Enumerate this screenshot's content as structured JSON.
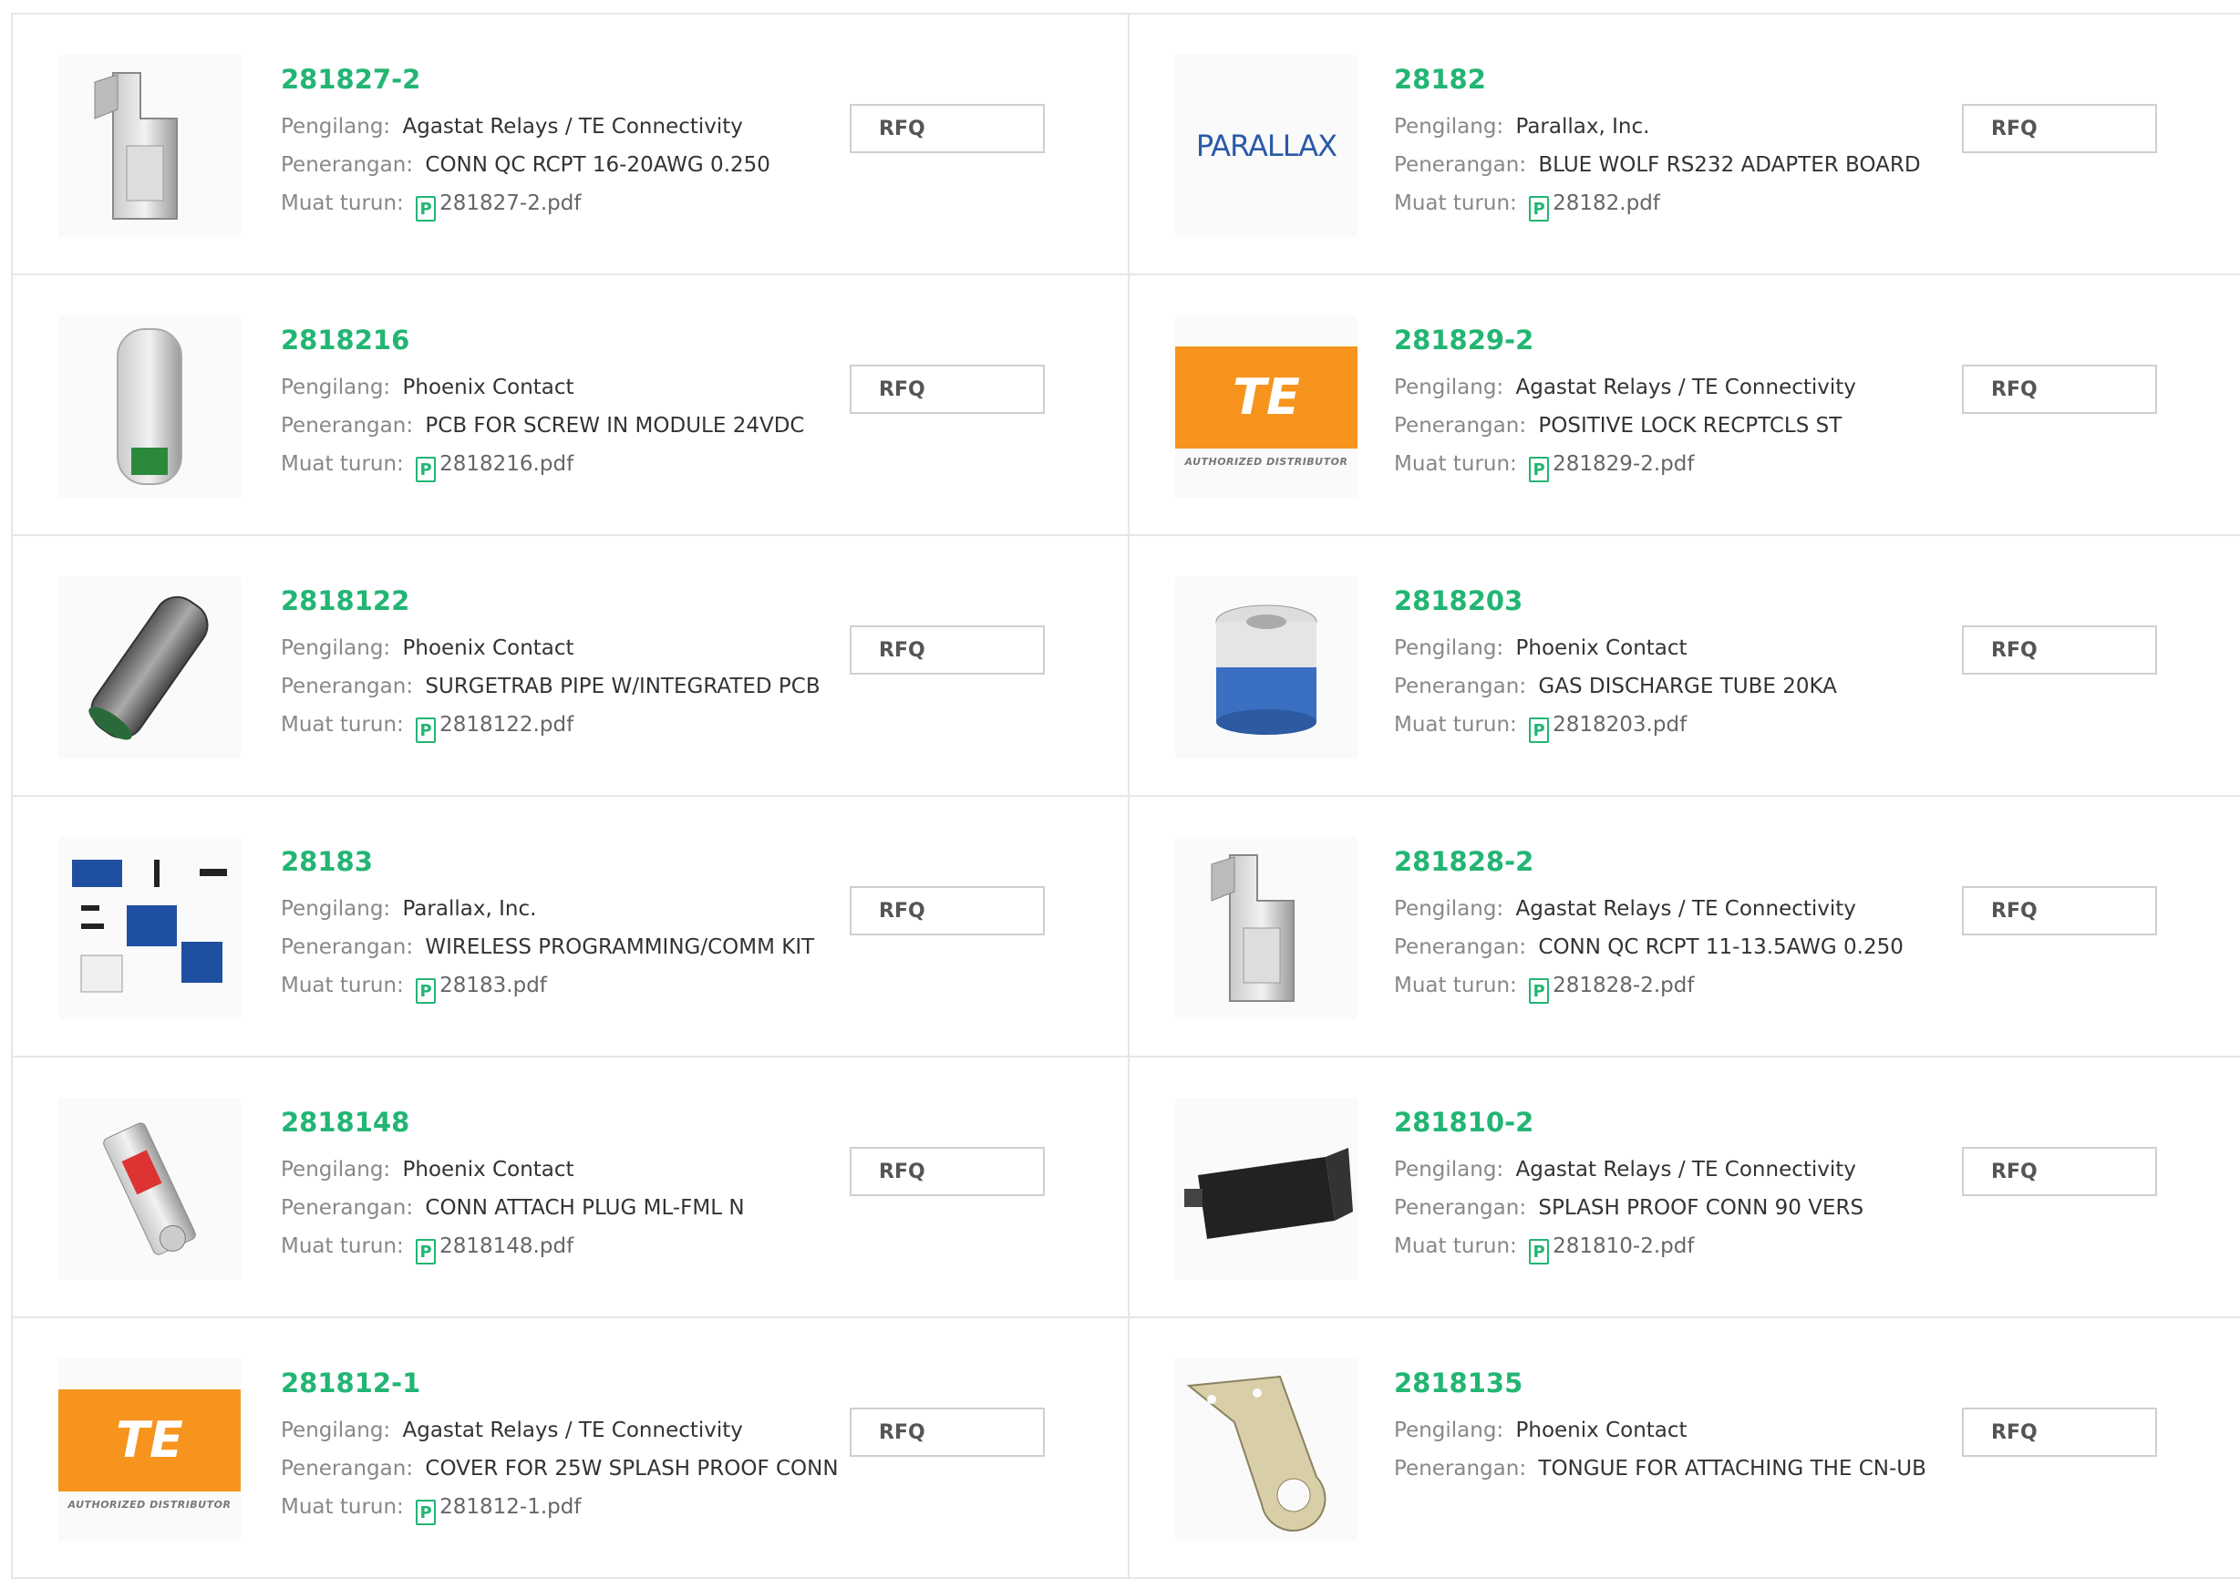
{
  "labels": {
    "manufacturer": "Pengilang:",
    "description": "Penerangan:",
    "download": "Muat turun:",
    "rfq": "RFQ"
  },
  "products": [
    {
      "part": "281827-2",
      "manufacturer": "Agastat Relays / TE Connectivity",
      "description": "CONN QC RCPT 16-20AWG 0.250",
      "file": "281827-2.pdf",
      "image": "terminal-icon"
    },
    {
      "part": "28182",
      "manufacturer": "Parallax, Inc.",
      "description": "BLUE WOLF RS232 ADAPTER BOARD",
      "file": "28182.pdf",
      "image": "parallax-logo",
      "logo_text": "PARALLAX"
    },
    {
      "part": "2818216",
      "manufacturer": "Phoenix Contact",
      "description": "PCB FOR SCREW IN MODULE 24VDC",
      "file": "2818216.pdf",
      "image": "module-icon"
    },
    {
      "part": "281829-2",
      "manufacturer": "Agastat Relays / TE Connectivity",
      "description": "POSITIVE LOCK RECPTCLS ST",
      "file": "281829-2.pdf",
      "image": "te-logo",
      "logo_text": "TE",
      "logo_sub": "AUTHORIZED DISTRIBUTOR"
    },
    {
      "part": "2818122",
      "manufacturer": "Phoenix Contact",
      "description": "SURGETRAB PIPE W/INTEGRATED PCB",
      "file": "2818122.pdf",
      "image": "pipe-icon"
    },
    {
      "part": "2818203",
      "manufacturer": "Phoenix Contact",
      "description": "GAS DISCHARGE TUBE 20KA",
      "file": "2818203.pdf",
      "image": "tube-icon"
    },
    {
      "part": "28183",
      "manufacturer": "Parallax, Inc.",
      "description": "WIRELESS PROGRAMMING/COMM KIT",
      "file": "28183.pdf",
      "image": "kit-icon"
    },
    {
      "part": "281828-2",
      "manufacturer": "Agastat Relays / TE Connectivity",
      "description": "CONN QC RCPT 11-13.5AWG 0.250",
      "file": "281828-2.pdf",
      "image": "terminal-icon"
    },
    {
      "part": "2818148",
      "manufacturer": "Phoenix Contact",
      "description": "CONN ATTACH PLUG ML-FML N",
      "file": "2818148.pdf",
      "image": "plug-icon"
    },
    {
      "part": "281810-2",
      "manufacturer": "Agastat Relays / TE Connectivity",
      "description": "SPLASH PROOF CONN 90 VERS",
      "file": "281810-2.pdf",
      "image": "connector-icon"
    },
    {
      "part": "281812-1",
      "manufacturer": "Agastat Relays / TE Connectivity",
      "description": "COVER FOR 25W SPLASH PROOF CONN",
      "file": "281812-1.pdf",
      "image": "te-logo",
      "logo_text": "TE",
      "logo_sub": "AUTHORIZED DISTRIBUTOR"
    },
    {
      "part": "2818135",
      "manufacturer": "Phoenix Contact",
      "description": "TONGUE FOR ATTACHING THE CN-UB",
      "file": null,
      "image": "tongue-icon"
    }
  ],
  "colors": {
    "accent": "#22b573",
    "te_orange": "#f7941d",
    "parallax_blue": "#2a5aa8"
  }
}
